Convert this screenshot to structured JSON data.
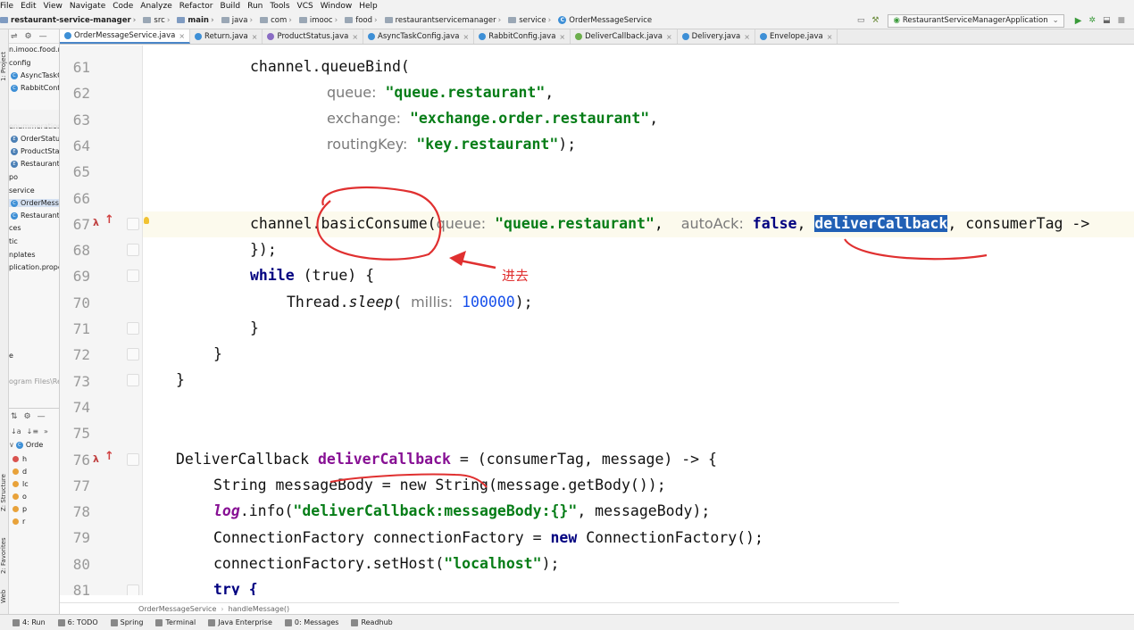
{
  "menu": [
    "File",
    "Edit",
    "View",
    "Navigate",
    "Code",
    "Analyze",
    "Refactor",
    "Build",
    "Run",
    "Tools",
    "VCS",
    "Window",
    "Help"
  ],
  "breadcrumb": {
    "project": "restaurant-service-manager",
    "items": [
      "src",
      "main",
      "java",
      "com",
      "imooc",
      "food",
      "restaurantservicemanager",
      "service"
    ],
    "file": "OrderMessageService"
  },
  "run_config": "RestaurantServiceManagerApplication",
  "left_stripe": {
    "project": "1: Project",
    "structure": "Z: Structure",
    "favorites": "2: Favorites",
    "web": "Web"
  },
  "project_tree": [
    {
      "label": "n.imooc.food.r",
      "type": "folder"
    },
    {
      "label": "config",
      "type": "folder"
    },
    {
      "label": "AsyncTaskC",
      "type": "class"
    },
    {
      "label": "RabbitConf",
      "type": "class"
    },
    {
      "label": "enummeration",
      "type": "folder"
    },
    {
      "label": "OrderStatu",
      "type": "enum"
    },
    {
      "label": "ProductSta",
      "type": "enum"
    },
    {
      "label": "Restaurant",
      "type": "enum"
    },
    {
      "label": "po",
      "type": "folder"
    },
    {
      "label": "service",
      "type": "folder"
    },
    {
      "label": "OrderMess",
      "type": "class",
      "selected": true
    },
    {
      "label": "RestaurantServ",
      "type": "class"
    },
    {
      "label": "ces",
      "type": "folder"
    },
    {
      "label": "tic",
      "type": "folder"
    },
    {
      "label": "nplates",
      "type": "folder"
    },
    {
      "label": "plication.prope",
      "type": "file"
    },
    {
      "label": "e",
      "type": "folder"
    },
    {
      "label": "ogram Files\\Re",
      "type": "folder"
    }
  ],
  "structure_tree": [
    "Orde",
    "h",
    "d",
    "lc",
    "o",
    "p",
    "r"
  ],
  "tabs": [
    {
      "label": "OrderMessageService.java",
      "icon": "class",
      "active": true
    },
    {
      "label": "Return.java",
      "icon": "class"
    },
    {
      "label": "ProductStatus.java",
      "icon": "enum"
    },
    {
      "label": "AsyncTaskConfig.java",
      "icon": "class"
    },
    {
      "label": "RabbitConfig.java",
      "icon": "class"
    },
    {
      "label": "DeliverCallback.java",
      "icon": "iface"
    },
    {
      "label": "Delivery.java",
      "icon": "class"
    },
    {
      "label": "Envelope.java",
      "icon": "class"
    }
  ],
  "code_lines": [
    "61",
    "62",
    "63",
    "64",
    "65",
    "66",
    "67",
    "68",
    "69",
    "70",
    "71",
    "72",
    "73",
    "74",
    "75",
    "76",
    "77",
    "78",
    "79",
    "80",
    "81"
  ],
  "code": {
    "l61": "channel.queueBind(",
    "l62_hint": "queue:",
    "l62_str": "\"queue.restaurant\"",
    "l63_hint": "exchange:",
    "l63_str": "\"exchange.order.restaurant\"",
    "l64_hint": "routingKey:",
    "l64_str": "\"key.restaurant\"",
    "l67_a": "channel.basicConsume(",
    "l67_hint1": "queue:",
    "l67_str": "\"queue.restaurant\"",
    "l67_hint2": "autoAck:",
    "l67_kw": "false",
    "l67_sel": "deliverCallback",
    "l67_rest": "consumerTag ->",
    "l68": "});",
    "l69_kw": "while",
    "l69_rest": " (true) {",
    "l70_a": "Thread.",
    "l70_i": "sleep",
    "l70_hint": "millis:",
    "l70_num": "100000",
    "l71": "}",
    "l72": "}",
    "l73": "}",
    "l76_a": "DeliverCallback ",
    "l76_field": "deliverCallback",
    "l76_rest": " = (consumerTag, message) -> {",
    "l77": "String messageBody = new String(message.getBody());",
    "l78_i": "log",
    "l78_a": ".info(",
    "l78_str": "\"deliverCallback:messageBody:{}\"",
    "l78_rest": ", messageBody);",
    "l79_a": "ConnectionFactory connectionFactory = ",
    "l79_kw": "new",
    "l79_rest": " ConnectionFactory();",
    "l80_a": "connectionFactory.setHost(",
    "l80_str": "\"localhost\"",
    "l80_rest": ");",
    "l81": "try {"
  },
  "annotation_note": "进去",
  "editor_breadcrumb": [
    "OrderMessageService",
    "handleMessage()"
  ],
  "tool_windows": [
    "4: Run",
    "6: TODO",
    "Spring",
    "Terminal",
    "Java Enterprise",
    "0: Messages",
    "Readhub"
  ],
  "colors": {
    "annotation_red": "#e03030",
    "selection": "#2160b5",
    "active_tab": "#4a86c8"
  }
}
